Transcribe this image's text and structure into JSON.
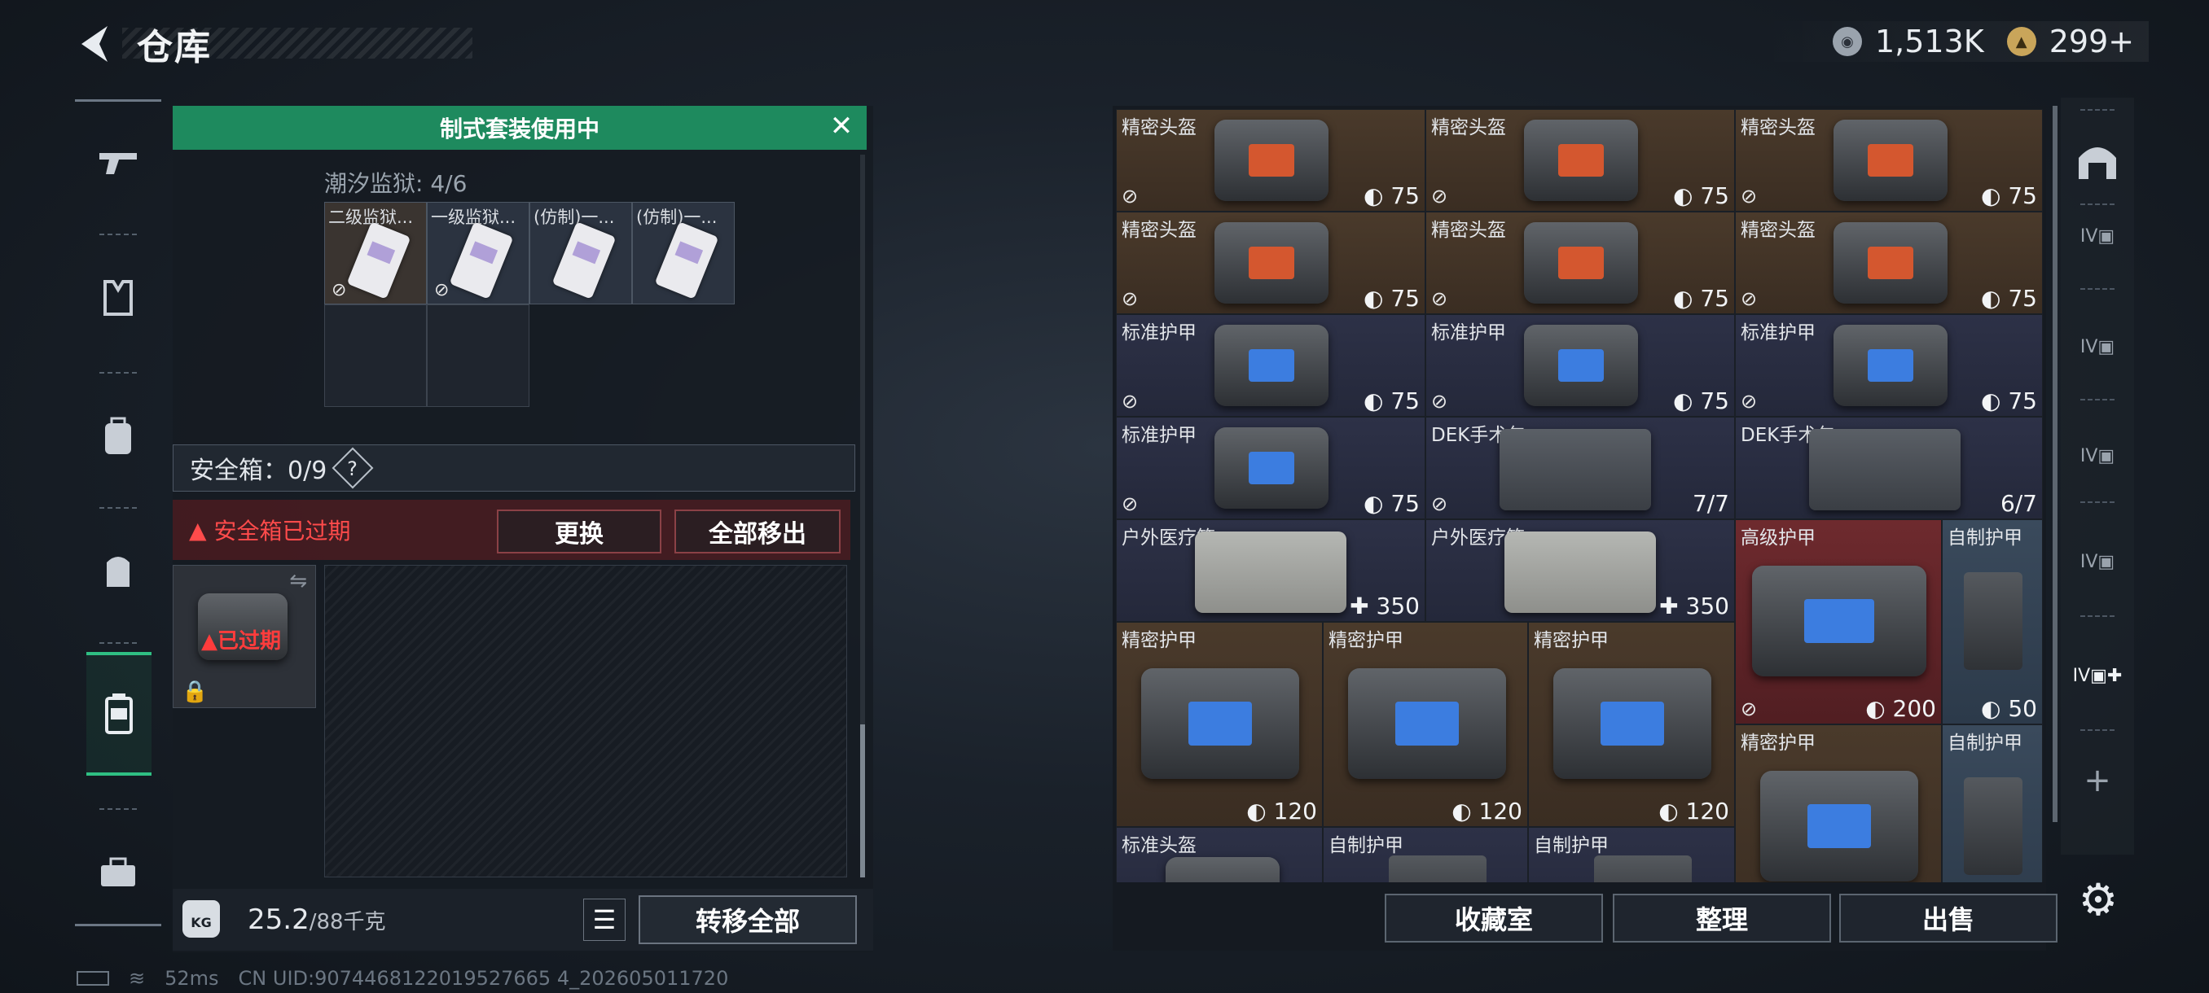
{
  "header": {
    "title": "仓库",
    "currency1": "1,513K",
    "currency2": "299+"
  },
  "sidebar": {
    "items": [
      "weapon-icon",
      "armor-icon",
      "backpack-icon",
      "chest-rig-icon",
      "safebox-icon",
      "toolbox-icon"
    ]
  },
  "banner": {
    "text": "制式套装使用中",
    "close_glyph": "✕"
  },
  "key_set": {
    "label": "潮汐监狱: 4/6",
    "keys": [
      "二级监狱...",
      "一级监狱...",
      "(仿制)一...",
      "(仿制)一..."
    ]
  },
  "safebox": {
    "label": "安全箱：0/9",
    "help": "?",
    "expired_msg": "安全箱已过期",
    "replace": "更换",
    "remove_all": "全部移出",
    "item_status": "已过期"
  },
  "footer_left": {
    "weight": "25.2",
    "weight_max": "/88千克",
    "kg": "KG",
    "transfer_all": "转移全部"
  },
  "status": {
    "ping": "52ms",
    "uid": "CN UID:9074468122019527665 4_202605011720"
  },
  "inventory": {
    "items": [
      {
        "name": "精密头盔",
        "value": "75"
      },
      {
        "name": "精密头盔",
        "value": "75"
      },
      {
        "name": "精密头盔",
        "value": "75"
      },
      {
        "name": "精密头盔",
        "value": "75"
      },
      {
        "name": "精密头盔",
        "value": "75"
      },
      {
        "name": "精密头盔",
        "value": "75"
      },
      {
        "name": "标准护甲",
        "value": "75"
      },
      {
        "name": "标准护甲",
        "value": "75"
      },
      {
        "name": "标准护甲",
        "value": "75"
      },
      {
        "name": "标准护甲",
        "value": "75"
      },
      {
        "name": "DEK手术包",
        "value": "7/7"
      },
      {
        "name": "DEK手术包",
        "value": "6/7"
      },
      {
        "name": "户外医疗箱",
        "value": "350"
      },
      {
        "name": "户外医疗箱",
        "value": "350"
      },
      {
        "name": "高级护甲",
        "value": "200"
      },
      {
        "name": "自制护甲",
        "value": "50"
      },
      {
        "name": "精密护甲",
        "value": "120"
      },
      {
        "name": "精密护甲",
        "value": "120"
      },
      {
        "name": "精密护甲",
        "value": "120"
      },
      {
        "name": "精密护甲",
        "value": ""
      },
      {
        "name": "自制护甲",
        "value": ""
      },
      {
        "name": "标准头盔",
        "value": ""
      },
      {
        "name": "自制护甲",
        "value": ""
      },
      {
        "name": "自制护甲",
        "value": ""
      }
    ]
  },
  "footer_right": {
    "collection": "收藏室",
    "sort": "整理",
    "sell": "出售"
  },
  "right_sidebar": {
    "tier": "IV",
    "add": "+"
  }
}
